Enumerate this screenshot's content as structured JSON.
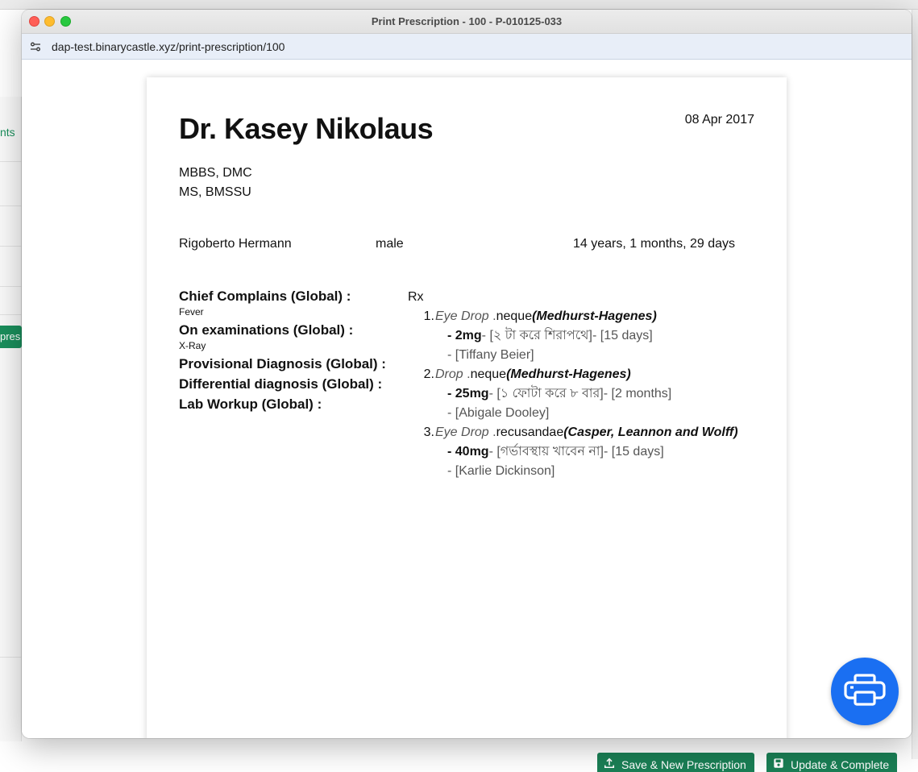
{
  "window": {
    "title": "Print Prescription - 100 - P-010125-033",
    "url": "dap-test.binarycastle.xyz/print-prescription/100"
  },
  "background": {
    "sidebar_fragment": "nts",
    "button_fragment": "pres",
    "save_new_label": "Save & New Prescription",
    "update_complete_label": "Update & Complete",
    "accent": "#1a8f5c"
  },
  "prescription": {
    "doctor_name": "Dr. Kasey Nikolaus",
    "date": "08 Apr 2017",
    "degrees": [
      "MBBS, DMC",
      "MS, BMSSU"
    ],
    "patient": {
      "name": "Rigoberto Hermann",
      "gender": "male",
      "age": "14 years, 1 months, 29 days"
    },
    "sections": {
      "chief_complaints": {
        "title": "Chief Complains (Global) :",
        "value": "Fever"
      },
      "on_examinations": {
        "title": "On examinations (Global) :",
        "value": "X-Ray"
      },
      "provisional_diagnosis": {
        "title": "Provisional Diagnosis (Global) :"
      },
      "differential_diagnosis": {
        "title": "Differential diagnosis (Global) :"
      },
      "lab_workup": {
        "title": "Lab Workup (Global) :"
      }
    },
    "rx": {
      "heading": "Rx",
      "items": [
        {
          "num": "1.",
          "form": "Eye Drop",
          "dot": " .",
          "name": "neque",
          "company": "(Medhurst-Hagenes)",
          "dose": "- 2mg",
          "instruction": "- [২ টা করে শিরাপথে]",
          "duration": "- [15 days]",
          "note": "- [Tiffany Beier]"
        },
        {
          "num": "2.",
          "form": "Drop",
          "dot": " .",
          "name": "neque",
          "company": "(Medhurst-Hagenes)",
          "dose": "- 25mg",
          "instruction": "- [১ ফোটা করে ৮ বার]",
          "duration": "- [2 months]",
          "note": "- [Abigale Dooley]"
        },
        {
          "num": "3.",
          "form": "Eye Drop",
          "dot": " .",
          "name": "recusandae",
          "company": "(Casper, Leannon and Wolff)",
          "dose": "- 40mg",
          "instruction": "- [গর্ভাবস্থায় খাবেন না]",
          "duration": "- [15 days]",
          "note": "- [Karlie Dickinson]"
        }
      ]
    }
  },
  "icons": {
    "site_settings": "sliders-icon",
    "print": "printer-icon",
    "upload": "upload-icon",
    "save": "floppy-disk-icon"
  },
  "colors": {
    "print_button": "#1a6ff2",
    "app_green": "#1a7f55"
  }
}
